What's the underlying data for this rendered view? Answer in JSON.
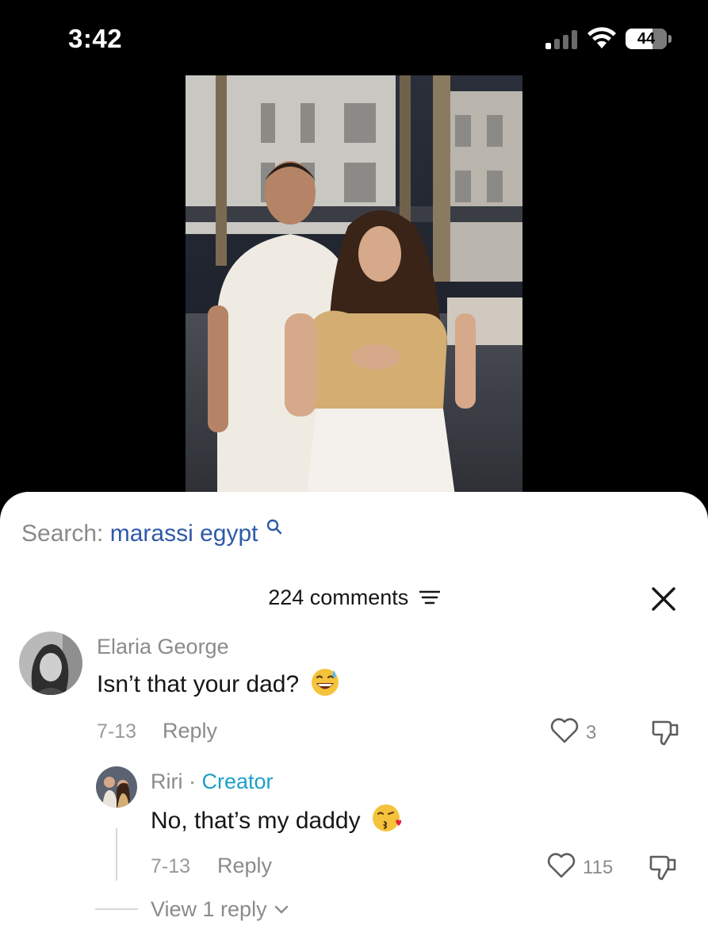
{
  "status_bar": {
    "time": "3:42",
    "battery": "44"
  },
  "search": {
    "label": "Search:",
    "query": "marassi egypt"
  },
  "comments_panel": {
    "count_label": "224 comments"
  },
  "comments": [
    {
      "username": "Elaria George",
      "text": "Isn’t that your dad?",
      "emoji": "sweat-smile",
      "date": "7-13",
      "reply_label": "Reply",
      "likes": "3",
      "replies": [
        {
          "username": "Riri",
          "separator": " · ",
          "badge": "Creator",
          "text": "No, that’s my daddy",
          "emoji": "kissing-heart",
          "date": "7-13",
          "reply_label": "Reply",
          "likes": "115"
        }
      ],
      "view_more_label": "View 1 reply"
    }
  ],
  "colors": {
    "accent_link": "#2f5aa8",
    "creator": "#1ca0c8",
    "muted": "#8b8b8b"
  }
}
